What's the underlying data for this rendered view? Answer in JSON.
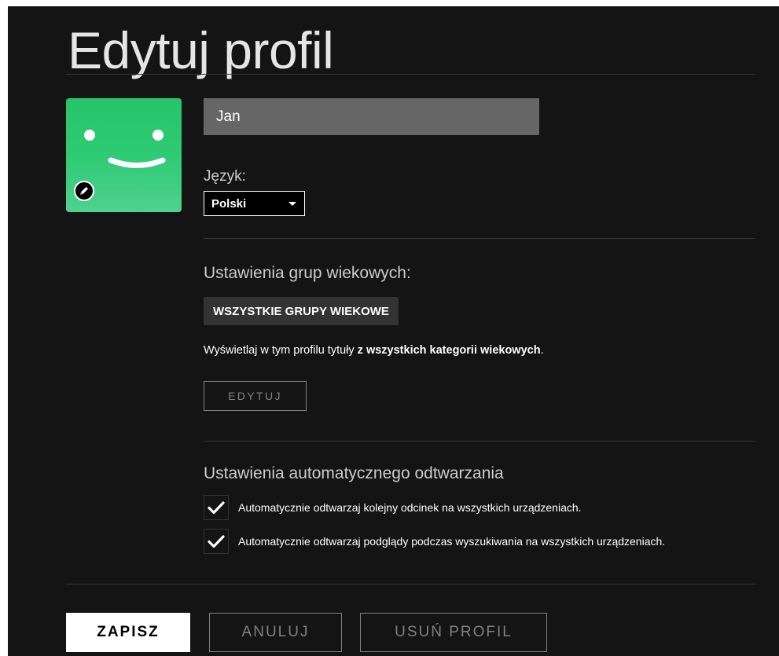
{
  "page": {
    "title": "Edytuj profil"
  },
  "profile": {
    "name": "Jan",
    "avatar_icon": "smiley-face-avatar",
    "edit_avatar_icon": "pencil-icon",
    "avatar_color": "#2ecb74"
  },
  "language": {
    "label": "Język:",
    "selected": "Polski"
  },
  "maturity": {
    "title": "Ustawienia grup wiekowych:",
    "badge": "WSZYSTKIE GRUPY WIEKOWE",
    "desc_prefix": "Wyświetlaj w tym profilu tytuły ",
    "desc_bold": "z wszystkich kategorii wiekowych",
    "desc_suffix": ".",
    "edit_button": "EDYTUJ"
  },
  "autoplay": {
    "title": "Ustawienia automatycznego odtwarzania",
    "options": [
      {
        "label": "Automatycznie odtwarzaj kolejny odcinek na wszystkich urządzeniach.",
        "checked": true
      },
      {
        "label": "Automatycznie odtwarzaj podglądy podczas wyszukiwania na wszystkich urządzeniach.",
        "checked": true
      }
    ]
  },
  "actions": {
    "save": "ZAPISZ",
    "cancel": "ANULUJ",
    "delete": "USUŃ PROFIL"
  },
  "colors": {
    "background": "#141414",
    "input_bg": "#666666",
    "muted": "#808080"
  }
}
